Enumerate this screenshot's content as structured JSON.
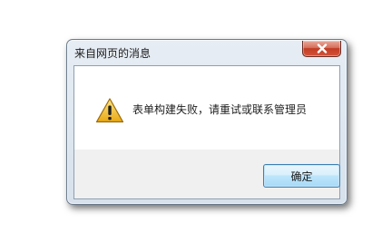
{
  "dialog": {
    "title": "来自网页的消息",
    "message": "表单构建失败，请重试或联系管理员",
    "ok_label": "确定",
    "icon": "warning-icon",
    "close_icon": "close-icon"
  },
  "colors": {
    "close_button": "#c13b23",
    "ok_button_border": "#3c7fb1",
    "warning_yellow": "#f2c230"
  }
}
